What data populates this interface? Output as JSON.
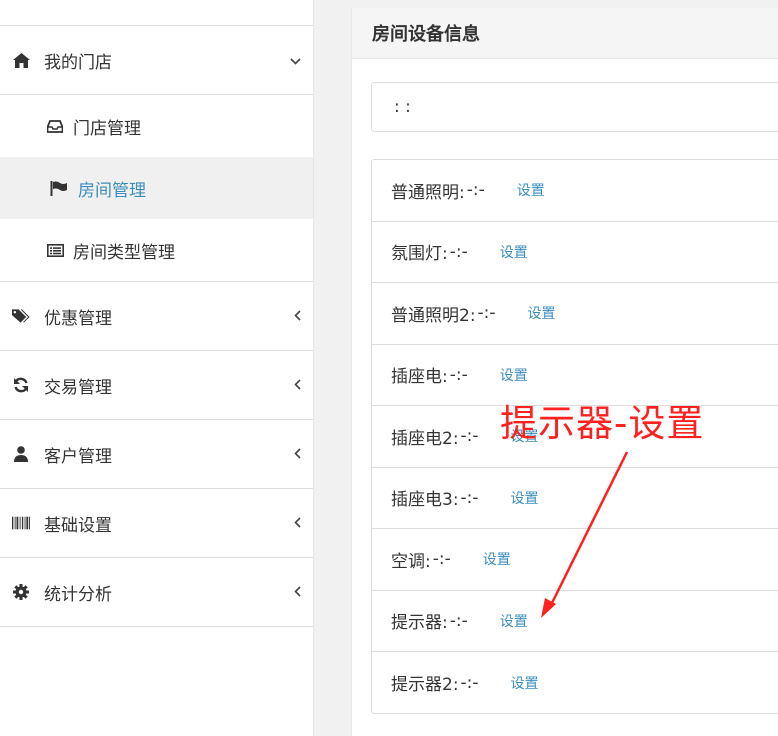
{
  "sidebar": {
    "my_store": {
      "label": "我的门店",
      "icon": "home-icon",
      "chevron": "⌄"
    },
    "sub_items": [
      {
        "label": "门店管理",
        "icon": "inbox-icon",
        "active": false
      },
      {
        "label": "房间管理",
        "icon": "flag-icon",
        "active": true
      },
      {
        "label": "房间类型管理",
        "icon": "list-alt-icon",
        "active": false
      }
    ],
    "items": [
      {
        "label": "优惠管理",
        "icon": "tags-icon",
        "chevron": "‹"
      },
      {
        "label": "交易管理",
        "icon": "refresh-icon",
        "chevron": "‹"
      },
      {
        "label": "客户管理",
        "icon": "user-icon",
        "chevron": "‹"
      },
      {
        "label": "基础设置",
        "icon": "barcode-icon",
        "chevron": "‹"
      },
      {
        "label": "统计分析",
        "icon": "gear-icon",
        "chevron": "‹"
      }
    ]
  },
  "panel": {
    "title": "房间设备信息",
    "info_text": ":  :",
    "devices": [
      {
        "name": "普通照明:",
        "status": "-:-",
        "action": "设置"
      },
      {
        "name": "氛围灯:",
        "status": "-:-",
        "action": "设置"
      },
      {
        "name": "普通照明2:",
        "status": "-:-",
        "action": "设置"
      },
      {
        "name": "插座电:",
        "status": "-:-",
        "action": "设置"
      },
      {
        "name": "插座电2:",
        "status": "-:-",
        "action": "设置"
      },
      {
        "name": "插座电3:",
        "status": "-:-",
        "action": "设置"
      },
      {
        "name": "空调:",
        "status": "-:-",
        "action": "设置"
      },
      {
        "name": "提示器:",
        "status": "-:-",
        "action": "设置"
      },
      {
        "name": "提示器2:",
        "status": "-:-",
        "action": "设置"
      }
    ]
  },
  "annotation": {
    "text": "提示器-设置",
    "color": "#ff2020"
  },
  "colors": {
    "accent": "#3c8dbc",
    "annotation": "#ff2020"
  }
}
